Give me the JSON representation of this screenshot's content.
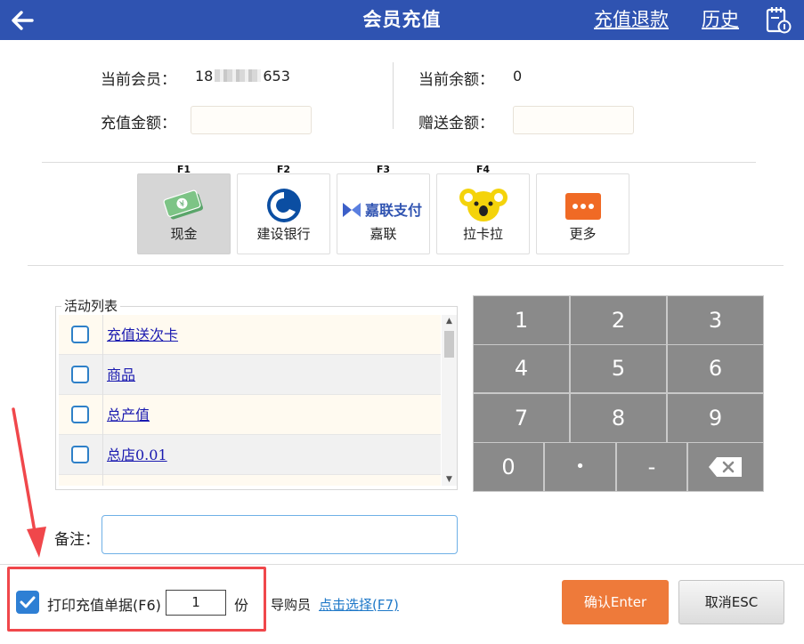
{
  "header": {
    "title": "会员充值",
    "refund_link": "充值退款",
    "history_link": "历史"
  },
  "info": {
    "member_label": "当前会员：",
    "member_prefix": "18",
    "member_suffix": "653",
    "balance_label": "当前余额：",
    "balance_value": "0",
    "amount_label": "充值金额：",
    "amount_value": "",
    "bonus_label": "赠送金额：",
    "bonus_value": ""
  },
  "payments": [
    {
      "key": "F1",
      "name": "现金",
      "icon": "cash-icon",
      "selected": true
    },
    {
      "key": "F2",
      "name": "建设银行",
      "icon": "ccb-bank-icon",
      "selected": false
    },
    {
      "key": "F3",
      "name": "嘉联",
      "icon": "jialian-pay-icon",
      "logo_text": "嘉联支付",
      "selected": false
    },
    {
      "key": "F4",
      "name": "拉卡拉",
      "icon": "lakala-koala-icon",
      "selected": false
    },
    {
      "key": "",
      "name": "更多",
      "icon": "more-dots-icon",
      "selected": false
    }
  ],
  "activities": {
    "title": "活动列表",
    "items": [
      {
        "name": "充值送次卡",
        "checked": false
      },
      {
        "name": "商品",
        "checked": false
      },
      {
        "name": "总产值",
        "checked": false
      },
      {
        "name": "总店0.01",
        "checked": false
      }
    ]
  },
  "keypad": {
    "rows": [
      [
        "1",
        "2",
        "3"
      ],
      [
        "4",
        "5",
        "6"
      ],
      [
        "7",
        "8",
        "9"
      ]
    ],
    "bottom": [
      "0",
      "•",
      "-"
    ],
    "backspace_icon": "backspace-icon"
  },
  "notes": {
    "label": "备注：",
    "value": ""
  },
  "footer": {
    "print_label": "打印充值单据(F6)",
    "print_checked": true,
    "copies_value": "1",
    "copies_unit": "份",
    "guide_label": "导购员",
    "guide_link": "点击选择(F7)",
    "confirm_label": "确认Enter",
    "cancel_label": "取消ESC"
  },
  "colors": {
    "header_bg": "#2f53b1",
    "confirm_bg": "#ee7a3a",
    "keypad_key": "#8a8a8a",
    "link": "#1a1ab0",
    "annotation": "#f0474b"
  }
}
